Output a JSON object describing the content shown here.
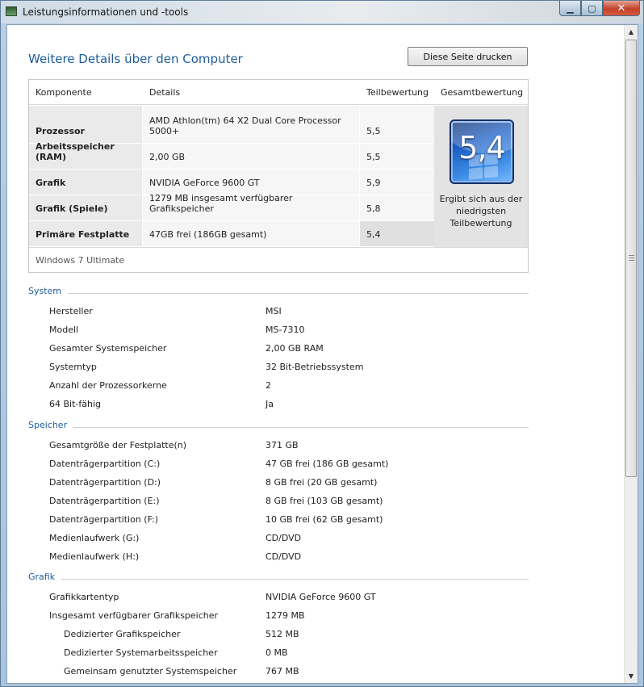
{
  "window": {
    "title": "Leistungsinformationen und -tools",
    "min": "▁",
    "max": "▢",
    "close": "✕"
  },
  "page": {
    "heading": "Weitere Details über den Computer",
    "print_button": "Diese Seite drucken"
  },
  "rating": {
    "headers": {
      "component": "Komponente",
      "details": "Details",
      "subscore": "Teilbewertung",
      "base": "Gesamtbewertung"
    },
    "rows": [
      {
        "component": "Prozessor",
        "details": "AMD Athlon(tm) 64 X2 Dual Core Processor 5000+",
        "subscore": "5,5"
      },
      {
        "component": "Arbeitsspeicher (RAM)",
        "details": "2,00 GB",
        "subscore": "5,5"
      },
      {
        "component": "Grafik",
        "details": "NVIDIA GeForce 9600 GT",
        "subscore": "5,9"
      },
      {
        "component": "Grafik (Spiele)",
        "details": "1279 MB insgesamt verfügbarer Grafikspeicher",
        "subscore": "5,8"
      },
      {
        "component": "Primäre Festplatte",
        "details": "47GB frei (186GB gesamt)",
        "subscore": "5,4"
      }
    ],
    "base_score": "5,4",
    "base_desc": "Ergibt sich aus der niedrigsten Teilbewertung",
    "edition": "Windows 7 Ultimate"
  },
  "sections": [
    {
      "title": "System",
      "items": [
        {
          "label": "Hersteller",
          "value": "MSI",
          "indent": 0
        },
        {
          "label": "Modell",
          "value": "MS-7310",
          "indent": 0
        },
        {
          "label": "Gesamter Systemspeicher",
          "value": "2,00 GB RAM",
          "indent": 0
        },
        {
          "label": "Systemtyp",
          "value": "32 Bit-Betriebssystem",
          "indent": 0
        },
        {
          "label": "Anzahl der Prozessorkerne",
          "value": "2",
          "indent": 0
        },
        {
          "label": "64 Bit-fähig",
          "value": "Ja",
          "indent": 0
        }
      ]
    },
    {
      "title": "Speicher",
      "items": [
        {
          "label": "Gesamtgröße der Festplatte(n)",
          "value": "371 GB",
          "indent": 0
        },
        {
          "label": "Datenträgerpartition (C:)",
          "value": "47 GB frei (186 GB gesamt)",
          "indent": 0
        },
        {
          "label": "Datenträgerpartition (D:)",
          "value": "8 GB frei (20 GB gesamt)",
          "indent": 0
        },
        {
          "label": "Datenträgerpartition (E:)",
          "value": "8 GB frei (103 GB gesamt)",
          "indent": 0
        },
        {
          "label": "Datenträgerpartition (F:)",
          "value": "10 GB frei (62 GB gesamt)",
          "indent": 0
        },
        {
          "label": "Medienlaufwerk (G:)",
          "value": "CD/DVD",
          "indent": 0
        },
        {
          "label": "Medienlaufwerk (H:)",
          "value": "CD/DVD",
          "indent": 0
        }
      ]
    },
    {
      "title": "Grafik",
      "items": [
        {
          "label": "Grafikkartentyp",
          "value": "NVIDIA GeForce 9600 GT",
          "indent": 0
        },
        {
          "label": "Insgesamt verfügbarer Grafikspeicher",
          "value": "1279 MB",
          "indent": 0
        },
        {
          "label": "Dedizierter Grafikspeicher",
          "value": "512 MB",
          "indent": 1
        },
        {
          "label": "Dedizierter Systemarbeitsspeicher",
          "value": "0 MB",
          "indent": 1
        },
        {
          "label": "Gemeinsam genutzter Systemspeicher",
          "value": "767 MB",
          "indent": 1
        }
      ]
    }
  ]
}
